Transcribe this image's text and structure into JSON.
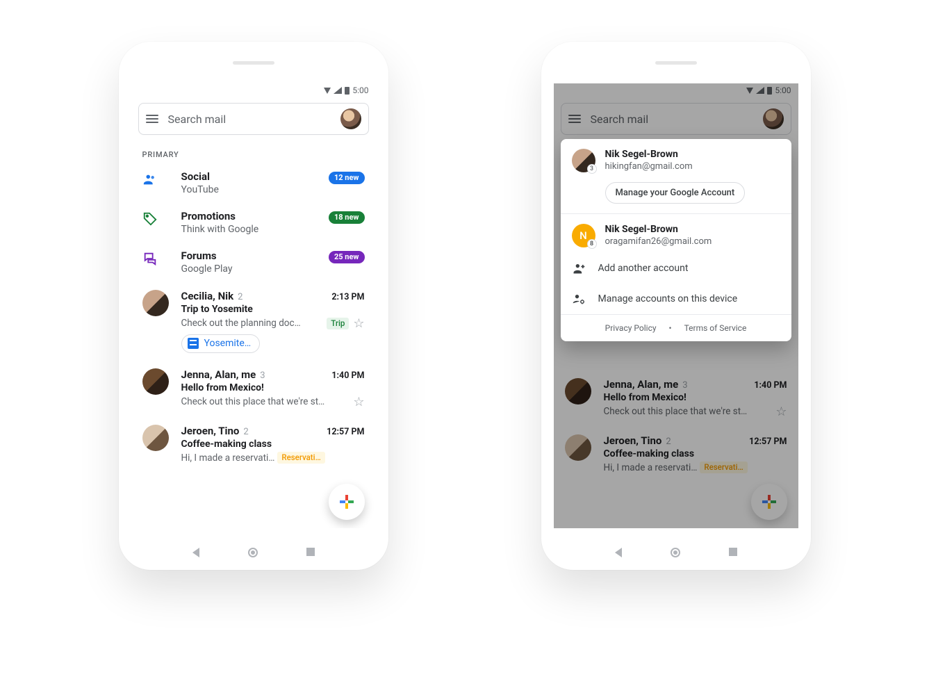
{
  "status": {
    "time": "5:00"
  },
  "search": {
    "placeholder": "Search mail"
  },
  "section_label": "PRIMARY",
  "categories": [
    {
      "title": "Social",
      "sub": "YouTube",
      "pill": "12 new",
      "pill_color": "blue"
    },
    {
      "title": "Promotions",
      "sub": "Think with Google",
      "pill": "18 new",
      "pill_color": "green"
    },
    {
      "title": "Forums",
      "sub": "Google Play",
      "pill": "25 new",
      "pill_color": "purple"
    }
  ],
  "threads": [
    {
      "from": "Cecilia, Nik",
      "count": "2",
      "time": "2:13 PM",
      "subject": "Trip to Yosemite",
      "snippet": "Check out the planning doc…",
      "label": "Trip",
      "label_style": "trip",
      "attachment": "Yosemite…"
    },
    {
      "from": "Jenna, Alan, me",
      "count": "3",
      "time": "1:40 PM",
      "subject": "Hello from Mexico!",
      "snippet": "Check out this place that we're st…"
    },
    {
      "from": "Jeroen, Tino",
      "count": "2",
      "time": "12:57 PM",
      "subject": "Coffee-making class",
      "snippet": "Hi, I made a reservati…",
      "label": "Reservati…",
      "label_style": "res"
    }
  ],
  "threads_right": [
    {
      "from": "Jenna, Alan, me",
      "count": "3",
      "time": "1:40 PM",
      "subject": "Hello from Mexico!",
      "snippet": "Check out this place that we're st…"
    },
    {
      "from": "Jeroen, Tino",
      "count": "2",
      "time": "12:57 PM",
      "subject": "Coffee-making class",
      "snippet": "Hi, I made a reservati…",
      "label": "Reservati…",
      "label_style": "res"
    }
  ],
  "account_switcher": {
    "primary": {
      "name": "Nik Segel-Brown",
      "email": "hikingfan@gmail.com",
      "badge": "3"
    },
    "manage": "Manage your Google Account",
    "secondary": {
      "name": "Nik Segel-Brown",
      "email": "oragamifan26@gmail.com",
      "badge": "8",
      "initial": "N"
    },
    "add": "Add another account",
    "manage_device": "Manage accounts on this device",
    "privacy": "Privacy Policy",
    "dot": "•",
    "tos": "Terms of Service"
  }
}
